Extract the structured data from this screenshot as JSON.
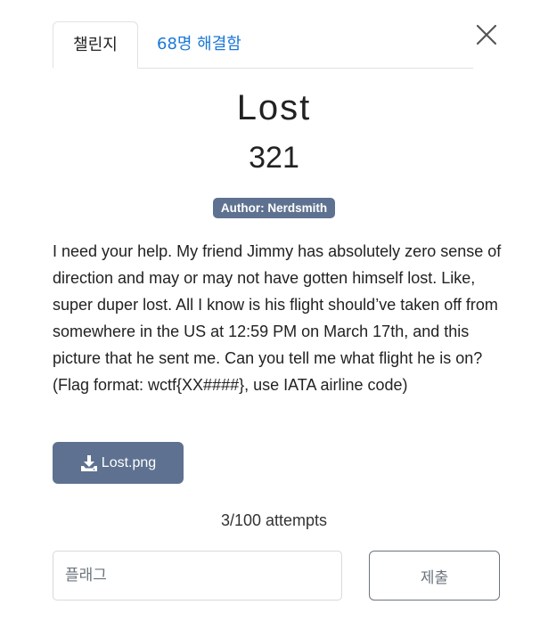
{
  "tabs": [
    {
      "label": "챌린지",
      "active": true
    },
    {
      "label": "68명 해결함",
      "active": false
    }
  ],
  "challenge": {
    "name": "Lost",
    "points": "321",
    "author": "Author: Nerdsmith",
    "description": "I need your help. My friend Jimmy has absolutely zero sense of direction and may or may not have gotten himself lost. Like, super duper lost. All I know is his flight should’ve taken off from somewhere in the US at 12:59 PM on March 17th, and this picture that he sent me. Can you tell me what flight he is on? (Flag format: wctf{XX####}, use IATA airline code)",
    "file": {
      "name": "Lost.png",
      "icon": "download-icon"
    }
  },
  "attempts": "3/100 attempts",
  "form": {
    "flag_placeholder": "플래그",
    "submit_label": "제출"
  },
  "icons": {
    "close": "close-icon"
  },
  "colors": {
    "badge_bg": "#5e7190",
    "file_button_bg": "#5e7190",
    "link": "#1a78d6",
    "text": "#222222",
    "muted": "#6c757d"
  }
}
